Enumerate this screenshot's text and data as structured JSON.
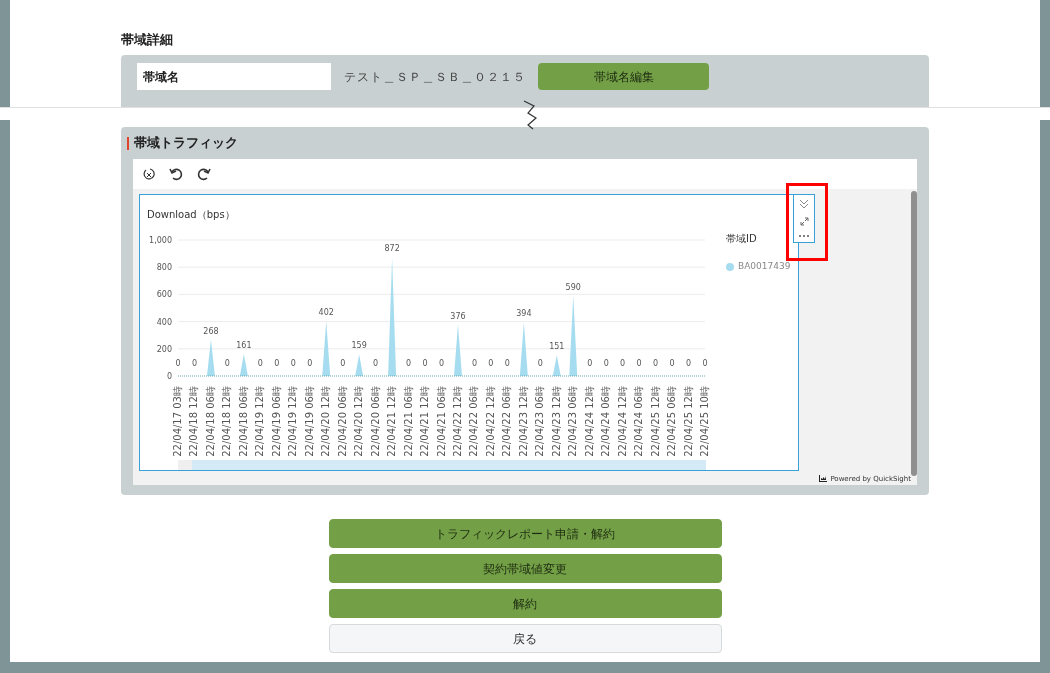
{
  "details": {
    "title": "帯域詳細",
    "rows": [
      {
        "label": "帯域名",
        "value": "テスト＿ＳＰ＿ＳＢ＿０２１５",
        "button": "帯域名編集"
      }
    ]
  },
  "traffic": {
    "title": "帯域トラフィック",
    "visual": {
      "title": "Download（bps）",
      "legend_title": "帯域ID",
      "chart_data": {
        "type": "area",
        "grid": true,
        "ylim": [
          0,
          1000
        ],
        "yticks": [
          0,
          200,
          400,
          600,
          800,
          {
            "value": 1000,
            "label": "1,000"
          }
        ],
        "data_labels": true,
        "categories": [
          "22/04/17 03時",
          "22/04/18 12時",
          "22/04/18 06時",
          "22/04/18 12時",
          "22/04/18 06時",
          "22/04/19 12時",
          "22/04/19 06時",
          "22/04/19 12時",
          "22/04/19 06時",
          "22/04/20 12時",
          "22/04/20 06時",
          "22/04/20 12時",
          "22/04/20 06時",
          "22/04/21 12時",
          "22/04/21 06時",
          "22/04/21 12時",
          "22/04/21 06時",
          "22/04/22 12時",
          "22/04/22 06時",
          "22/04/22 12時",
          "22/04/22 06時",
          "22/04/23 12時",
          "22/04/23 06時",
          "22/04/23 12時",
          "22/04/23 06時",
          "22/04/24 12時",
          "22/04/24 06時",
          "22/04/24 12時",
          "22/04/24 06時",
          "22/04/25 12時",
          "22/04/25 06時",
          "22/04/25 12時",
          "22/04/25 10時"
        ],
        "series": [
          {
            "name": "BA0017439",
            "color": "#a6dcef",
            "values": [
              0,
              0,
              268,
              0,
              161,
              0,
              0,
              0,
              0,
              402,
              0,
              159,
              0,
              872,
              0,
              0,
              0,
              376,
              0,
              0,
              0,
              394,
              0,
              151,
              590,
              0,
              0,
              0,
              0,
              0,
              0,
              0,
              0
            ]
          }
        ]
      }
    },
    "footer": "Powered by QuickSight"
  },
  "actions": [
    {
      "label": "トラフィックレポート申請・解約",
      "kind": "primary"
    },
    {
      "label": "契約帯域値変更",
      "kind": "primary"
    },
    {
      "label": "解約",
      "kind": "primary"
    },
    {
      "label": "戻る",
      "kind": "secondary"
    }
  ]
}
